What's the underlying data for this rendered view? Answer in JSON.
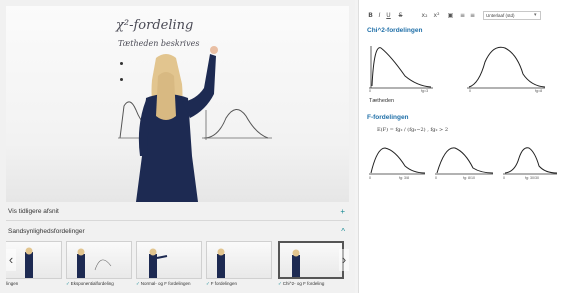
{
  "video": {
    "board_title": "χ²-fordeling",
    "board_line1": "Tætheden beskrives"
  },
  "sections": {
    "earlier": {
      "label": "Vis tidligere afsnit",
      "toggle": "+"
    },
    "distributions": {
      "label": "Sandsynlighedsfordelinger",
      "toggle": "^"
    }
  },
  "thumbnails": [
    {
      "caption": "fordelingen",
      "checked": false
    },
    {
      "caption": "Eksponentialfordeling",
      "checked": true
    },
    {
      "caption": "Normal- og F fordelingen",
      "checked": true
    },
    {
      "caption": "F fordelingen",
      "checked": true
    },
    {
      "caption": "Chi^2- og F fordeling",
      "checked": true
    }
  ],
  "carousel": {
    "prev": "‹",
    "next": "›"
  },
  "toolbar": {
    "bold": "B",
    "italic": "I",
    "underline": "U",
    "strike": "S",
    "sub": "x₂",
    "sup": "x²",
    "image": "▣",
    "list_ol": "≡",
    "list_ul": "≡",
    "font_select": "Unterlaaf (std)"
  },
  "notes": {
    "chi_title": "Chi^2-fordelingen",
    "chi_left_axis": {
      "start": "0",
      "end": "fg=3"
    },
    "chi_right_axis": {
      "start": "0",
      "end": "fg=8"
    },
    "chi_note": "Tætheden",
    "f_title": "F-fordelingen",
    "f_formula": "E(F) = fg₂ / (fg₂−2)    , fg₂ > 2",
    "f_axes": [
      {
        "start": "0",
        "end": "fg: 3/8"
      },
      {
        "start": "0",
        "end": "fg: 8/10"
      },
      {
        "start": "0",
        "end": "fg: 30/30"
      }
    ]
  },
  "colors": {
    "accent": "#1a8a94",
    "heading": "#1f6fa8",
    "sweater": "#1d2a52",
    "hair": "#e2c58f"
  }
}
